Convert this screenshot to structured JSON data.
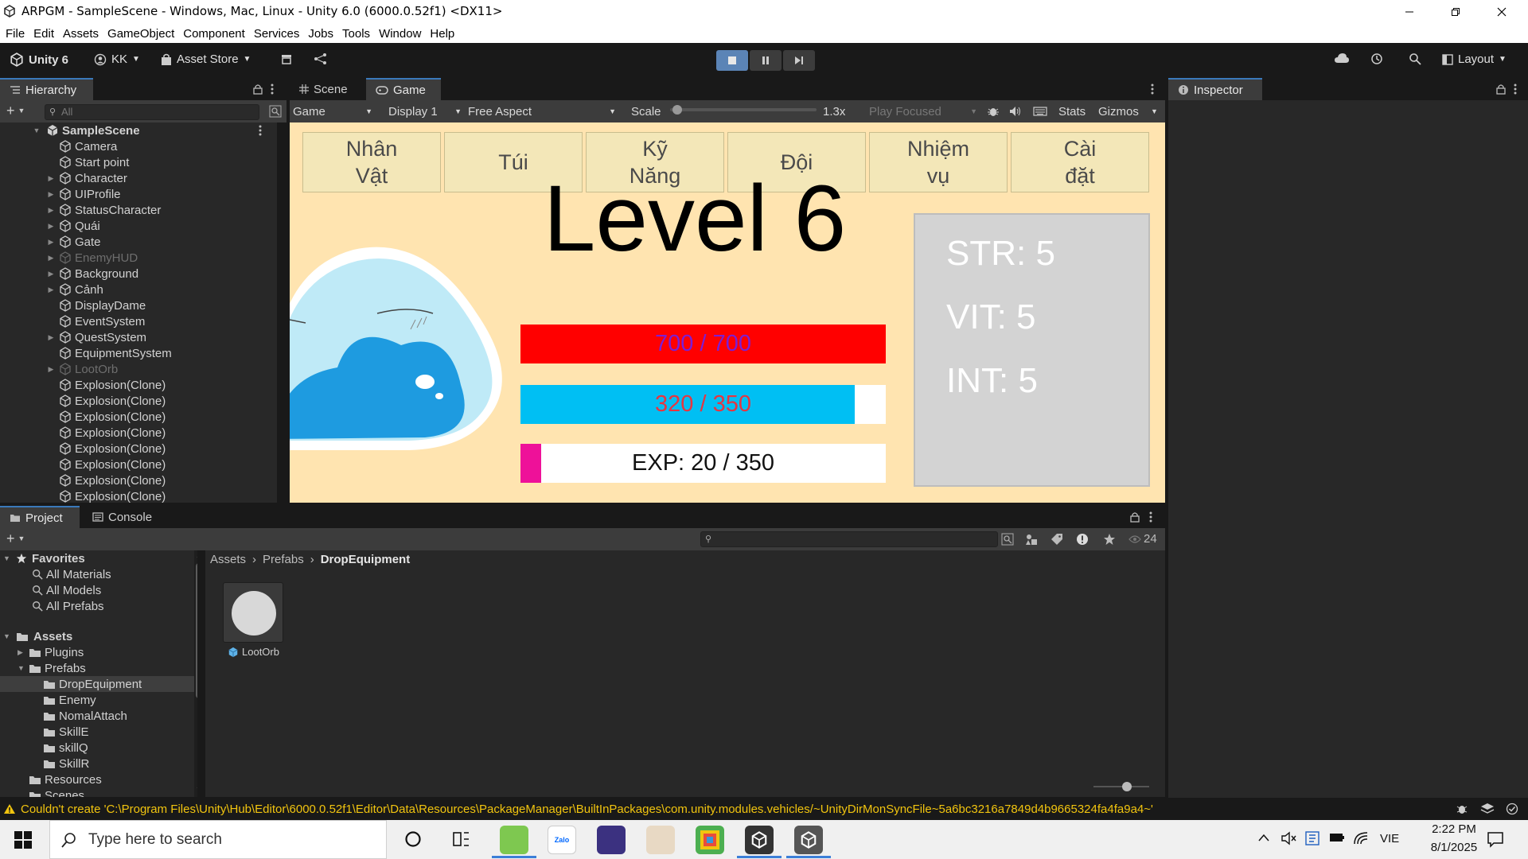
{
  "window": {
    "title": "ARPGM - SampleScene - Windows, Mac, Linux - Unity 6.0 (6000.0.52f1) <DX11>"
  },
  "menu": [
    "File",
    "Edit",
    "Assets",
    "GameObject",
    "Component",
    "Services",
    "Jobs",
    "Tools",
    "Window",
    "Help"
  ],
  "toolbar": {
    "unity_label": "Unity 6",
    "account_label": "KK",
    "asset_store_label": "Asset Store",
    "layout_label": "Layout"
  },
  "hierarchy": {
    "tab_label": "Hierarchy",
    "search_placeholder": "All",
    "scene_name": "SampleScene",
    "items": [
      {
        "label": "Camera",
        "expandable": false,
        "dim": false
      },
      {
        "label": "Start point",
        "expandable": false,
        "dim": false
      },
      {
        "label": "Character",
        "expandable": true,
        "dim": false
      },
      {
        "label": "UIProfile",
        "expandable": true,
        "dim": false
      },
      {
        "label": "StatusCharacter",
        "expandable": true,
        "dim": false
      },
      {
        "label": "Quái",
        "expandable": true,
        "dim": false
      },
      {
        "label": "Gate",
        "expandable": true,
        "dim": false
      },
      {
        "label": "EnemyHUD",
        "expandable": true,
        "dim": true
      },
      {
        "label": "Background",
        "expandable": true,
        "dim": false
      },
      {
        "label": "Cảnh",
        "expandable": true,
        "dim": false
      },
      {
        "label": "DisplayDame",
        "expandable": false,
        "dim": false
      },
      {
        "label": "EventSystem",
        "expandable": false,
        "dim": false
      },
      {
        "label": "QuestSystem",
        "expandable": true,
        "dim": false
      },
      {
        "label": "EquipmentSystem",
        "expandable": false,
        "dim": false
      },
      {
        "label": "LootOrb",
        "expandable": true,
        "dim": true
      },
      {
        "label": "Explosion(Clone)",
        "expandable": false,
        "dim": false
      },
      {
        "label": "Explosion(Clone)",
        "expandable": false,
        "dim": false
      },
      {
        "label": "Explosion(Clone)",
        "expandable": false,
        "dim": false
      },
      {
        "label": "Explosion(Clone)",
        "expandable": false,
        "dim": false
      },
      {
        "label": "Explosion(Clone)",
        "expandable": false,
        "dim": false
      },
      {
        "label": "Explosion(Clone)",
        "expandable": false,
        "dim": false
      },
      {
        "label": "Explosion(Clone)",
        "expandable": false,
        "dim": false
      },
      {
        "label": "Explosion(Clone)",
        "expandable": false,
        "dim": false
      }
    ]
  },
  "center_tabs": {
    "scene": "Scene",
    "game": "Game"
  },
  "game_toolbar": {
    "view": "Game",
    "display": "Display 1",
    "aspect": "Free Aspect",
    "scale_label": "Scale",
    "scale_value": "1.3x",
    "scale_fraction": 0.02,
    "play_mode": "Play Focused",
    "stats": "Stats",
    "gizmos": "Gizmos"
  },
  "game": {
    "menu_buttons": [
      "Nhân\nVật",
      "Túi",
      "Kỹ\nNăng",
      "Đội",
      "Nhiệm\nvụ",
      "Cài\nđặt"
    ],
    "level_text": "Level 6",
    "hp_text": "700 / 700",
    "hp_fraction": 1.0,
    "mp_text": "320 / 350",
    "mp_fraction": 0.914,
    "exp_text": "EXP: 20 / 350",
    "exp_fraction": 0.057,
    "stats": [
      "STR: 5",
      "VIT: 5",
      "INT: 5"
    ],
    "colors": {
      "hp": "#ff0000",
      "hp_text": "#7a1fd6",
      "mp": "#00bff3",
      "mp_text": "#e8353f",
      "exp": "#ee1199",
      "bg": "#ffe4b0"
    }
  },
  "inspector": {
    "tab_label": "Inspector"
  },
  "project": {
    "tabs": [
      "Project",
      "Console"
    ],
    "hidden_count": "24",
    "favorites_label": "Favorites",
    "favorites": [
      "All Materials",
      "All Models",
      "All Prefabs"
    ],
    "assets_label": "Assets",
    "tree": [
      {
        "label": "Plugins",
        "level": 1,
        "expandable": true,
        "selected": false
      },
      {
        "label": "Prefabs",
        "level": 1,
        "expandable": true,
        "selected": false
      },
      {
        "label": "DropEquipment",
        "level": 2,
        "expandable": false,
        "selected": true
      },
      {
        "label": "Enemy",
        "level": 2,
        "expandable": false,
        "selected": false
      },
      {
        "label": "NomalAttach",
        "level": 2,
        "expandable": false,
        "selected": false
      },
      {
        "label": "SkillE",
        "level": 2,
        "expandable": false,
        "selected": false
      },
      {
        "label": "skillQ",
        "level": 2,
        "expandable": false,
        "selected": false
      },
      {
        "label": "SkillR",
        "level": 2,
        "expandable": false,
        "selected": false
      },
      {
        "label": "Resources",
        "level": 1,
        "expandable": false,
        "selected": false
      },
      {
        "label": "Scenes",
        "level": 1,
        "expandable": false,
        "selected": false
      }
    ],
    "breadcrumb": [
      "Assets",
      "Prefabs",
      "DropEquipment"
    ],
    "asset_name": "LootOrb"
  },
  "status": {
    "message": "Couldn't create 'C:\\Program Files\\Unity\\Hub\\Editor\\6000.0.52f1\\Editor\\Data\\Resources\\PackageManager\\BuiltInPackages\\com.unity.modules.vehicles/~UnityDirMonSyncFile~5a6bc3216a7849d4b9665324fa4fa9a4~'"
  },
  "taskbar": {
    "search_placeholder": "Type here to search",
    "lang": "VIE",
    "time": "2:22 PM",
    "date": "8/1/2025"
  }
}
